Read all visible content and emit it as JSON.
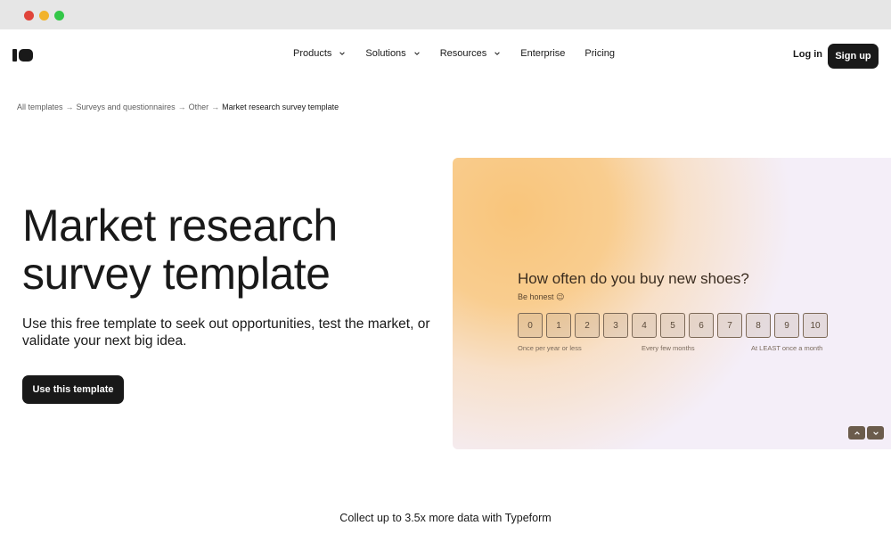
{
  "nav": {
    "items": [
      {
        "label": "Products",
        "has_menu": true
      },
      {
        "label": "Solutions",
        "has_menu": true
      },
      {
        "label": "Resources",
        "has_menu": true
      },
      {
        "label": "Enterprise",
        "has_menu": false
      },
      {
        "label": "Pricing",
        "has_menu": false
      }
    ],
    "login_label": "Log in",
    "signup_label": "Sign up"
  },
  "breadcrumb": {
    "items": [
      "All templates",
      "Surveys and questionnaires",
      "Other"
    ],
    "current": "Market research survey template",
    "separator": "→"
  },
  "hero": {
    "title_line1": "Market research",
    "title_line2": "survey template",
    "subtitle": "Use this free template to seek out opportunities, test the market, or validate your next big idea.",
    "cta_label": "Use this template"
  },
  "preview": {
    "question": "How often do you buy new shoes?",
    "hint": "Be honest 😉",
    "scale": [
      "0",
      "1",
      "2",
      "3",
      "4",
      "5",
      "6",
      "7",
      "8",
      "9",
      "10"
    ],
    "label_left": "Once per year or less",
    "label_mid": "Every few months",
    "label_right": "At LEAST once a month",
    "accent_color": "#f9c57b"
  },
  "footer": {
    "collect_text": "Collect up to 3.5x more data with Typeform"
  }
}
